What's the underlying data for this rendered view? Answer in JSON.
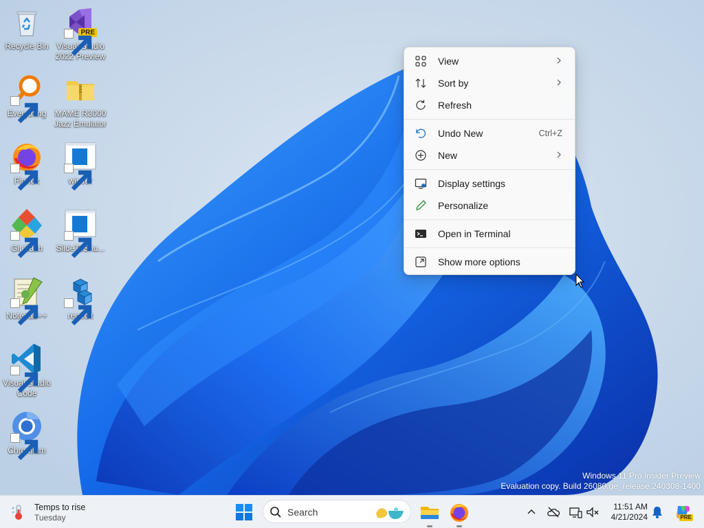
{
  "desktop": {
    "icons": [
      {
        "label": "Recycle Bin",
        "icon": "recycle-bin-icon"
      },
      {
        "label": "Visual Studio 2022 Preview",
        "line1": "Visual Studio",
        "line2": "2022 Preview",
        "icon": "visual-studio-preview-icon",
        "badge": "PRE"
      },
      {
        "label": "Everything",
        "icon": "everything-search-icon"
      },
      {
        "label": "MAME R3000 Jazz Emulator",
        "line1": "MAME R3000",
        "line2": "Jazz Emulator",
        "icon": "folder-zip-icon"
      },
      {
        "label": "Firefox",
        "icon": "firefox-icon"
      },
      {
        "label": "winver",
        "icon": "winver-icon"
      },
      {
        "label": "Git Bash",
        "icon": "git-bash-icon"
      },
      {
        "label": "SlideToShu...",
        "icon": "slidetoshutdown-icon"
      },
      {
        "label": "Notepad++",
        "icon": "notepad-plus-plus-icon"
      },
      {
        "label": "regedit",
        "icon": "regedit-icon"
      },
      {
        "label": "Visual Studio Code",
        "line1": "Visual Studio",
        "line2": "Code",
        "icon": "vscode-icon"
      },
      {
        "label": "Chromium",
        "icon": "chromium-icon"
      }
    ]
  },
  "context_menu": {
    "items": [
      {
        "label": "View",
        "icon": "grid-view-icon",
        "submenu": true
      },
      {
        "label": "Sort by",
        "icon": "sort-icon",
        "submenu": true
      },
      {
        "label": "Refresh",
        "icon": "refresh-icon"
      },
      {
        "label": "Undo New",
        "icon": "undo-icon",
        "shortcut": "Ctrl+Z"
      },
      {
        "label": "New",
        "icon": "plus-circle-icon",
        "submenu": true
      },
      {
        "label": "Display settings",
        "icon": "display-settings-icon"
      },
      {
        "label": "Personalize",
        "icon": "pen-icon"
      },
      {
        "label": "Open in Terminal",
        "icon": "terminal-icon"
      },
      {
        "label": "Show more options",
        "icon": "more-options-icon"
      }
    ]
  },
  "watermark": {
    "line1": "Windows 11 Pro Insider Preview",
    "line2": "Evaluation copy. Build 26080.ge_release.240308-1400"
  },
  "taskbar": {
    "weather": {
      "title": "Temps to rise",
      "subtitle": "Tuesday",
      "icon": "thermometer-icon"
    },
    "search_placeholder": "Search",
    "clock": {
      "time": "11:51 AM",
      "date": "4/21/2024"
    },
    "tray_icons": [
      "chevron-up-icon",
      "onedrive-offline-icon",
      "network-icon",
      "volume-muted-icon",
      "notification-bell-icon",
      "copilot-icon"
    ],
    "copilot_badge": "PRE"
  },
  "colors": {
    "accent": "#0067c0",
    "wallpaper_blue": "#1560e0",
    "menu_bg": "#f9f9f9"
  }
}
